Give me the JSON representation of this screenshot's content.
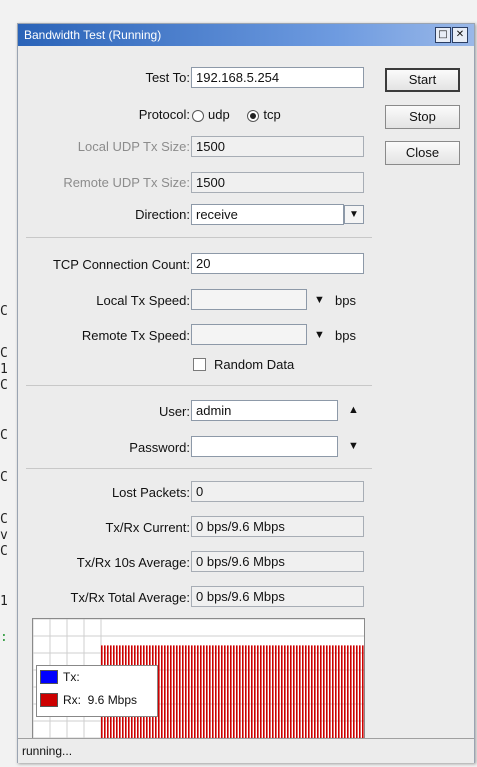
{
  "window": {
    "title": "Bandwidth Test (Running)"
  },
  "buttons": {
    "start": "Start",
    "stop": "Stop",
    "close": "Close"
  },
  "form": {
    "test_to": {
      "label": "Test To:",
      "value": "192.168.5.254"
    },
    "protocol": {
      "label": "Protocol:",
      "options": [
        "udp",
        "tcp"
      ],
      "selected": "tcp"
    },
    "local_udp_tx_size": {
      "label": "Local UDP Tx Size:",
      "value": "1500"
    },
    "remote_udp_tx_size": {
      "label": "Remote UDP Tx Size:",
      "value": "1500"
    },
    "direction": {
      "label": "Direction:",
      "value": "receive"
    },
    "tcp_connection_count": {
      "label": "TCP Connection Count:",
      "value": "20"
    },
    "local_tx_speed": {
      "label": "Local Tx Speed:",
      "value": "",
      "unit": "bps"
    },
    "remote_tx_speed": {
      "label": "Remote Tx Speed:",
      "value": "",
      "unit": "bps"
    },
    "random_data": {
      "label": "Random Data",
      "checked": false
    },
    "user": {
      "label": "User:",
      "value": "admin"
    },
    "password": {
      "label": "Password:",
      "value": ""
    }
  },
  "stats": {
    "lost_packets": {
      "label": "Lost Packets:",
      "value": "0"
    },
    "txrx_current": {
      "label": "Tx/Rx Current:",
      "value": "0 bps/9.6 Mbps"
    },
    "txrx_10s": {
      "label": "Tx/Rx 10s Average:",
      "value": "0 bps/9.6 Mbps"
    },
    "txrx_total": {
      "label": "Tx/Rx Total Average:",
      "value": "0 bps/9.6 Mbps"
    }
  },
  "graph": {
    "legend": {
      "tx_label": "Tx:",
      "rx_label": "Rx:",
      "rx_value": "9.6 Mbps"
    },
    "colors": {
      "tx": "#0000ff",
      "rx": "#cc0000"
    },
    "rx_fill_fraction": 0.78
  },
  "status_bar": {
    "text": "running..."
  },
  "background_terminal": {
    "lines": [
      "C",
      "C",
      "1",
      "C",
      "C",
      "C",
      "C",
      "v",
      "C",
      "1",
      ":"
    ]
  }
}
